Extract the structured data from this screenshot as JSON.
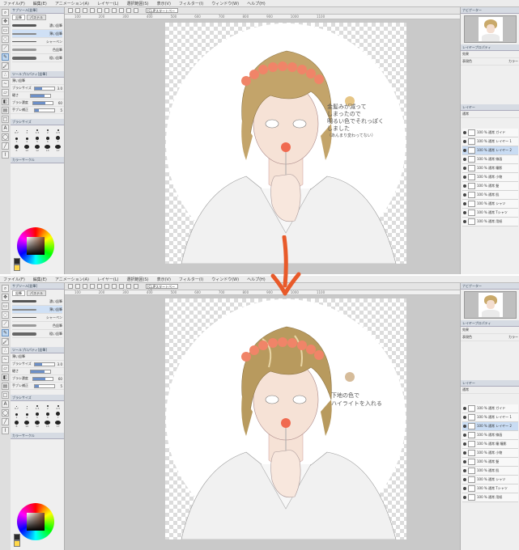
{
  "menu": [
    "ファイル(F)",
    "編集(E)",
    "アニメーション(A)",
    "レイヤー(L)",
    "選択範囲(S)",
    "表示(V)",
    "フィルター(I)",
    "ウィンドウ(W)",
    "ヘルプ(H)"
  ],
  "toolbar": {
    "zoom_select": "[CLIPスタートページ]"
  },
  "ruler_ticks": [
    "100",
    "200",
    "300",
    "400",
    "500",
    "600",
    "700",
    "800",
    "900",
    "1000",
    "1100"
  ],
  "left_panel": {
    "subtool_title": "サブツール[鉛筆]",
    "subtool_tabs": [
      "鉛筆",
      "パステル"
    ],
    "brushes": [
      "濃い鉛筆",
      "薄い鉛筆",
      "シャーペン",
      "色鉛筆",
      "粗い鉛筆"
    ],
    "tool_property_title": "ツールプロパティ[鉛筆]",
    "brush_name": "薄い鉛筆",
    "props": [
      {
        "label": "ブラシサイズ",
        "value": "3.0"
      },
      {
        "label": "硬さ",
        "value": ""
      },
      {
        "label": "ブラシ濃度",
        "value": "60"
      },
      {
        "label": "手ブレ補正",
        "value": "5"
      }
    ],
    "brush_size_title": "ブラシサイズ",
    "sizes": [
      "0.7",
      "1",
      "1.5",
      "2",
      "2.5",
      "3",
      "4",
      "5",
      "6",
      "7",
      "8",
      "10",
      "12",
      "15",
      "17",
      "20",
      "25",
      "30",
      "40",
      "50"
    ],
    "color_title": "カラーサークル"
  },
  "right_panel": {
    "navigator_title": "ナビゲーター",
    "layer_property_title": "レイヤープロパティ",
    "effect_label": "効果",
    "display_color_label": "表現色",
    "display_color_value": "カラー",
    "layer_title": "レイヤー",
    "blend_mode": "通常",
    "layers_top": [
      {
        "name": "100 % 通常 ガイド"
      },
      {
        "name": "100 % 通常 レイヤー 1"
      },
      {
        "name": "100 % 通常 レイヤー 2"
      },
      {
        "name": "100 % 通常 線画"
      },
      {
        "name": "100 % 通常 瞳影"
      },
      {
        "name": "100 % 通常 小物"
      },
      {
        "name": "100 % 通常 髪"
      },
      {
        "name": "100 % 通常 肌"
      },
      {
        "name": "100 % 通常 シャツ"
      },
      {
        "name": "100 % 通常 Tシャツ"
      },
      {
        "name": "100 % 通常 用紙"
      }
    ],
    "layers_bottom": [
      {
        "name": "100 % 通常 ガイド"
      },
      {
        "name": "100 % 通常 レイヤー 1"
      },
      {
        "name": "100 % 通常 レイヤー 2"
      },
      {
        "name": "100 % 通常 線画"
      },
      {
        "name": "100 % 通常 瞳 瞳影"
      },
      {
        "name": "100 % 通常 小物"
      },
      {
        "name": "100 % 通常 髪"
      },
      {
        "name": "100 % 通常 肌"
      },
      {
        "name": "100 % 通常 シャツ"
      },
      {
        "name": "100 % 通常 Tシャツ"
      },
      {
        "name": "100 % 通常 用紙"
      }
    ]
  },
  "annotations": {
    "top": [
      "金髪みが減って",
      "しまったので",
      "明るい色でそれっぽく",
      "しました",
      "（あんまり変わってない）"
    ],
    "bottom": [
      "下地の色で",
      "ハイライトを入れる"
    ]
  },
  "colors": {
    "hair": "#c3a46a",
    "hair_dark": "#8c7444",
    "flowers": "#f08468",
    "swatch_top": "#e6c585",
    "swatch_bottom": "#d6bc9a",
    "arrow": "#e85a2a",
    "skin": "#f6e2d6"
  }
}
